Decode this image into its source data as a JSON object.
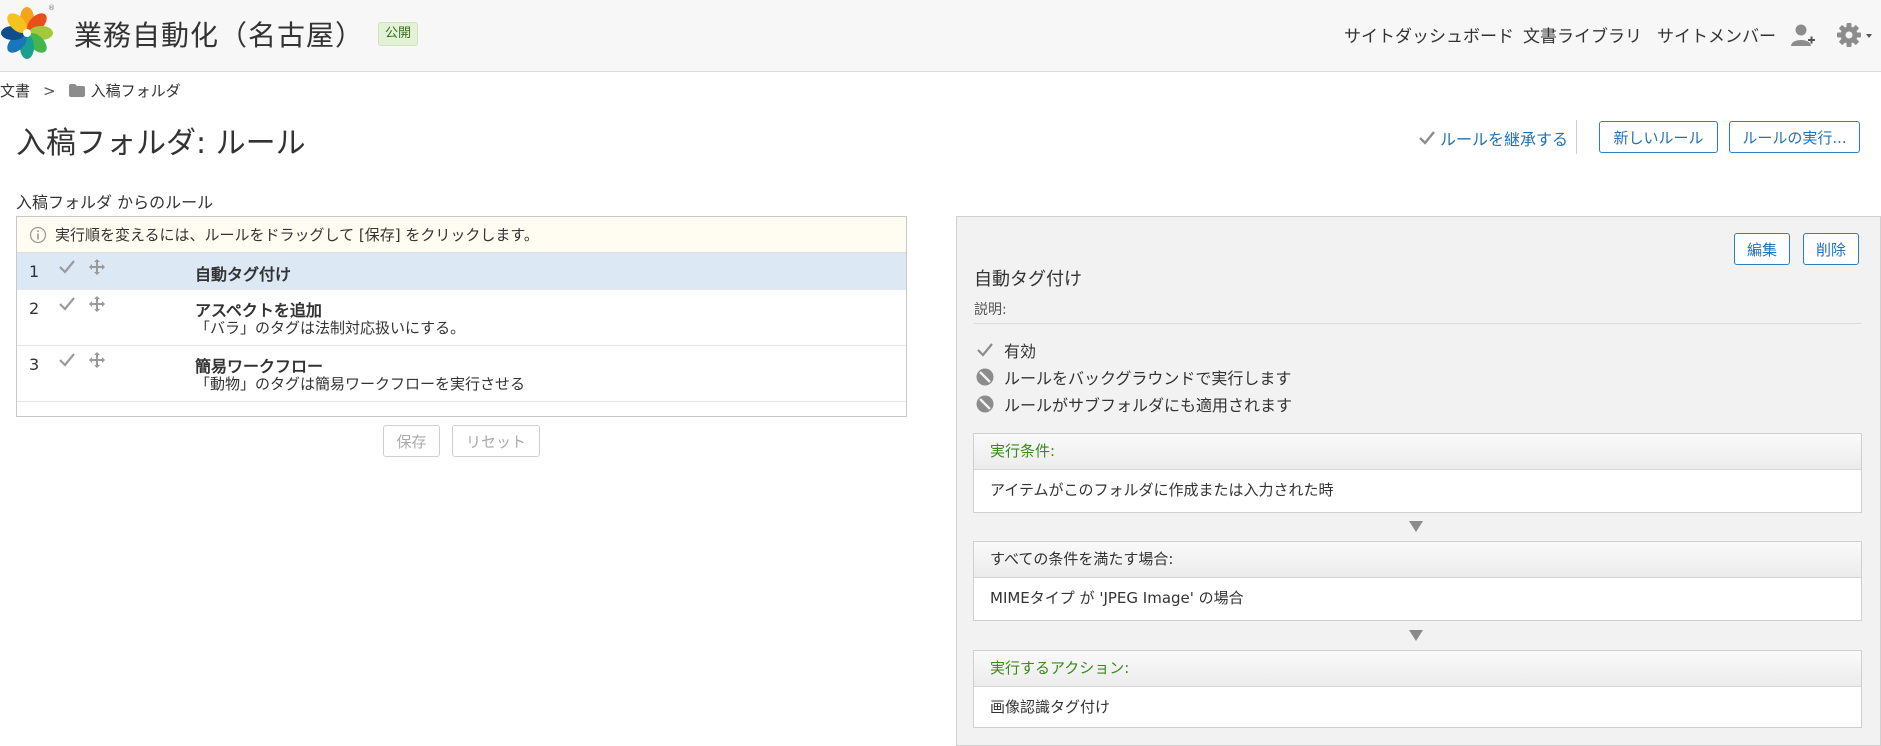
{
  "header": {
    "site_title": "業務自動化（名古屋）",
    "visibility_badge": "公開",
    "nav": [
      "サイトダッシュボード",
      "文書ライブラリ",
      "サイトメンバー"
    ],
    "icons": [
      "add-user-icon",
      "gear-icon"
    ]
  },
  "breadcrumb": {
    "root": "文書",
    "separator": ">",
    "folder": "入稿フォルダ"
  },
  "page_title": "入稿フォルダ: ルール",
  "toolbar": {
    "inherit_rules": "ルールを継承する",
    "new_rule": "新しいルール",
    "run_rules": "ルールの実行..."
  },
  "rules_section_label": "入稿フォルダ からのルール",
  "info_message": "実行順を変えるには、ルールをドラッグして [保存] をクリックします。",
  "rules": [
    {
      "index": "1",
      "title": "自動タグ付け",
      "description": "",
      "selected": true
    },
    {
      "index": "2",
      "title": "アスペクトを追加",
      "description": "「バラ」のタグは法制対応扱いにする。",
      "selected": false
    },
    {
      "index": "3",
      "title": "簡易ワークフロー",
      "description": "「動物」のタグは簡易ワークフローを実行させる",
      "selected": false
    }
  ],
  "list_actions": {
    "save": "保存",
    "reset": "リセット"
  },
  "detail": {
    "edit": "編集",
    "delete": "削除",
    "title": "自動タグ付け",
    "description_label": "説明:",
    "properties": [
      {
        "label": "有効",
        "state": "enabled"
      },
      {
        "label": "ルールをバックグラウンドで実行します",
        "state": "disabled"
      },
      {
        "label": "ルールがサブフォルダにも適用されます",
        "state": "disabled"
      }
    ],
    "when_header": "実行条件:",
    "when_body": "アイテムがこのフォルダに作成または入力された時",
    "if_header": "すべての条件を満たす場合:",
    "if_body": "MIMEタイプ が 'JPEG Image' の場合",
    "action_header": "実行するアクション:",
    "action_body": "画像認識タグ付け"
  },
  "colors": {
    "link_blue": "#2272b5",
    "selected_row": "#dce9f5",
    "green_header": "#3a8a1c",
    "badge_green": "#e2f2d6"
  }
}
